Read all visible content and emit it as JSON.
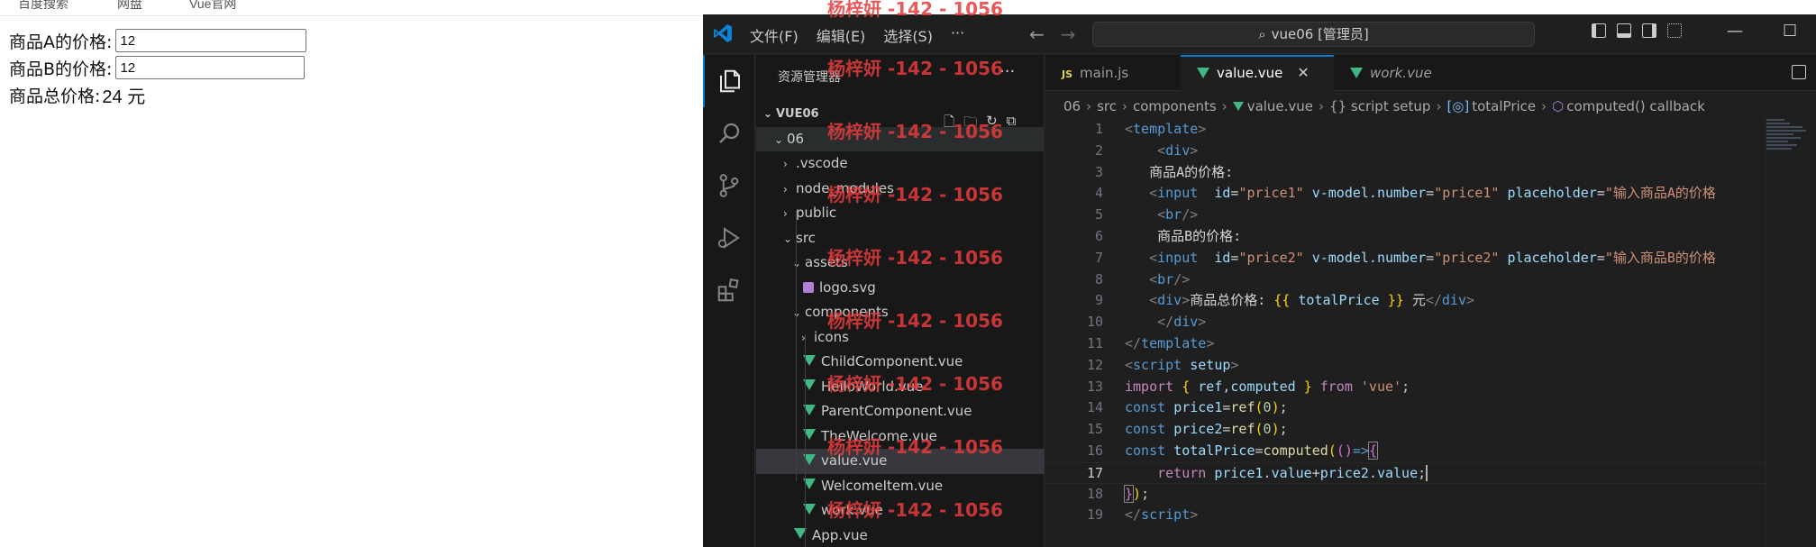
{
  "browser": {
    "bookmarks": [
      "百度搜索",
      "网盘",
      "Vue官网"
    ],
    "form": {
      "price_a_label": "商品A的价格:",
      "price_a_value": "12",
      "price_b_label": "商品B的价格:",
      "price_b_value": "12",
      "total_label": "商品总价格:",
      "total_value": "24 元"
    }
  },
  "titlebar": {
    "menu": [
      "文件(F)",
      "编辑(E)",
      "选择(S)",
      "···"
    ],
    "command_center": "vue06 [管理员]"
  },
  "sidebar": {
    "title": "资源管理器",
    "more": "···",
    "project": "VUE06",
    "tree": [
      {
        "label": "06",
        "type": "folder-open",
        "depth": 1
      },
      {
        "label": ".vscode",
        "type": "folder",
        "depth": 2
      },
      {
        "label": "node_modules",
        "type": "folder",
        "depth": 2
      },
      {
        "label": "public",
        "type": "folder",
        "depth": 2
      },
      {
        "label": "src",
        "type": "folder-open",
        "depth": 2
      },
      {
        "label": "assets",
        "type": "folder-open",
        "depth": 3
      },
      {
        "label": "logo.svg",
        "type": "svg",
        "depth": 4
      },
      {
        "label": "components",
        "type": "folder-open",
        "depth": 3
      },
      {
        "label": "icons",
        "type": "folder",
        "depth": 4
      },
      {
        "label": "ChildComponent.vue",
        "type": "vue",
        "depth": 4
      },
      {
        "label": "HelloWorld.vue",
        "type": "vue",
        "depth": 4
      },
      {
        "label": "ParentComponent.vue",
        "type": "vue",
        "depth": 4
      },
      {
        "label": "TheWelcome.vue",
        "type": "vue",
        "depth": 4
      },
      {
        "label": "value.vue",
        "type": "vue",
        "depth": 4
      },
      {
        "label": "WelcomeItem.vue",
        "type": "vue",
        "depth": 4
      },
      {
        "label": "work.vue",
        "type": "vue",
        "depth": 4
      },
      {
        "label": "App.vue",
        "type": "vue",
        "depth": 3
      }
    ]
  },
  "tabs": [
    {
      "label": "main.js",
      "icon": "JS"
    },
    {
      "label": "value.vue",
      "close": "✕"
    },
    {
      "label": "work.vue"
    }
  ],
  "breadcrumb": [
    "06",
    "src",
    "components",
    "value.vue",
    "{} script setup",
    "totalPrice",
    "computed() callback"
  ],
  "code": {
    "line_numbers": [
      "1",
      "2",
      "3",
      "4",
      "5",
      "6",
      "7",
      "8",
      "9",
      "10",
      "11",
      "12",
      "13",
      "14",
      "15",
      "16",
      "17",
      "18",
      "19"
    ],
    "current_line": 17
  },
  "watermark": "杨梓妍 -142 - 1056",
  "colors": {
    "accent": "#0078d4",
    "vue_green": "#41b883",
    "editor_bg": "#1f1f1f",
    "sidebar_bg": "#181818",
    "watermark": "#e63c3c"
  }
}
